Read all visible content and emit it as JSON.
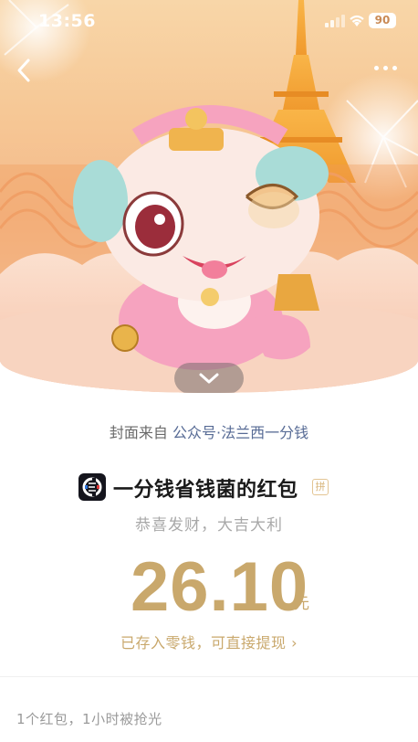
{
  "status_bar": {
    "time": "13:56",
    "battery": "90",
    "signal_icon": "signal-bars-icon",
    "wifi_icon": "wifi-icon"
  },
  "nav": {
    "back_icon": "chevron-left-icon",
    "more_icon": "more-dots-icon"
  },
  "cover": {
    "collapse_icon": "chevron-down-icon"
  },
  "source": {
    "prefix": "封面来自",
    "account": "公众号·法兰西一分钱"
  },
  "sender": {
    "name": "一分钱省钱菌的红包",
    "badge": "拼"
  },
  "greeting": "恭喜发财，大吉大利",
  "amount": {
    "value": "26.10",
    "currency": "元"
  },
  "withdraw_link": "已存入零钱，可直接提现 ›",
  "summary": "1个红包，1小时被抢光",
  "colors": {
    "gold": "#c9a86c",
    "link_blue": "#576b95",
    "cover_peach": "#f6c795"
  }
}
